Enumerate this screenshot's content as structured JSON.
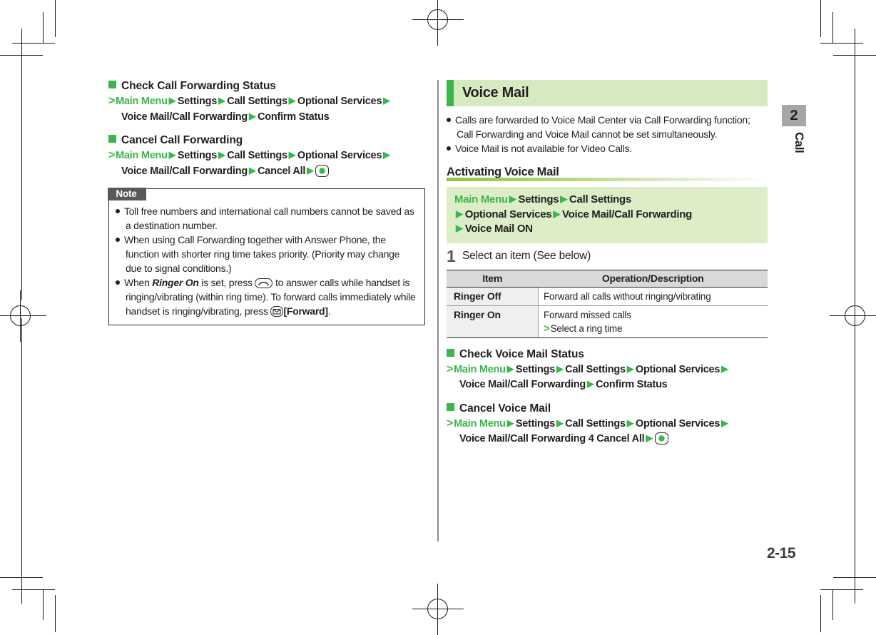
{
  "page": {
    "number": "2-15",
    "chapter_number": "2",
    "chapter_label": "Call"
  },
  "left_column": {
    "sections": [
      {
        "heading": "Check Call Forwarding Status",
        "path_line1_prefix": "＞",
        "path_tokens_line1": [
          "Main Menu",
          "Settings",
          "Call Settings",
          "Optional Services"
        ],
        "path_tokens_line2": [
          "Voice Mail/Call Forwarding",
          "Confirm Status"
        ]
      },
      {
        "heading": "Cancel Call Forwarding",
        "path_tokens_line1": [
          "Main Menu",
          "Settings",
          "Call Settings",
          "Optional Services"
        ],
        "path_tokens_line2": [
          "Voice Mail/Call Forwarding",
          "Cancel All"
        ]
      }
    ],
    "note": {
      "label": "Note",
      "items": [
        "Toll free numbers and international call numbers cannot be saved as a destination number.",
        "When using Call Forwarding together with Answer Phone, the function with shorter ring time takes priority. (Priority may change due to signal conditions.)"
      ],
      "item3": {
        "pre": "When ",
        "emph": "Ringer On",
        "mid1": " is set, press ",
        "mid2": " to answer calls while handset is ringing/vibrating (within ring time). To forward calls immediately while handset is ringing/vibrating, press ",
        "bracket": "[Forward]",
        "end": "."
      }
    }
  },
  "right_column": {
    "section_title": "Voice Mail",
    "intro_items": [
      "Calls are forwarded to Voice Mail Center via Call Forwarding function; Call Forwarding and Voice Mail cannot be set simultaneously.",
      "Voice Mail is not available for Video Calls."
    ],
    "sub_heading": "Activating Voice Mail",
    "menu_box": {
      "line1": [
        "Main Menu",
        "Settings",
        "Call Settings"
      ],
      "line2": [
        "Optional Services",
        "Voice Mail/Call Forwarding"
      ],
      "line3": [
        "Voice Mail ON"
      ]
    },
    "step": {
      "number": "1",
      "text": "Select an item (See below)"
    },
    "table": {
      "headers": [
        "Item",
        "Operation/Description"
      ],
      "rows": [
        {
          "item": "Ringer Off",
          "desc": "Forward all calls without ringing/vibrating",
          "sub": ""
        },
        {
          "item": "Ringer On",
          "desc": "Forward missed calls",
          "sub": "Select a ring time"
        }
      ]
    },
    "sections": [
      {
        "heading": "Check Voice Mail Status",
        "path_tokens_line1": [
          "Main Menu",
          "Settings",
          "Call Settings",
          "Optional Services"
        ],
        "path_tokens_line2": [
          "Voice Mail/Call Forwarding",
          "Confirm Status"
        ]
      },
      {
        "heading": "Cancel Voice Mail",
        "path_tokens_line1": [
          "Main Menu",
          "Settings",
          "Call Settings",
          "Optional Services"
        ],
        "path_line2_text": "Voice Mail/Call Forwarding 4 Cancel All"
      }
    ]
  },
  "colors": {
    "accent_green": "#3CB54A",
    "title_bg": "#D6EAC2",
    "menu_box_bg": "#DCEDC8",
    "note_tab_bg": "#595959",
    "table_header_bg": "#D9D9D9",
    "table_item_bg": "#EFEFEF",
    "chapter_chip_bg": "#A6A6A6"
  }
}
